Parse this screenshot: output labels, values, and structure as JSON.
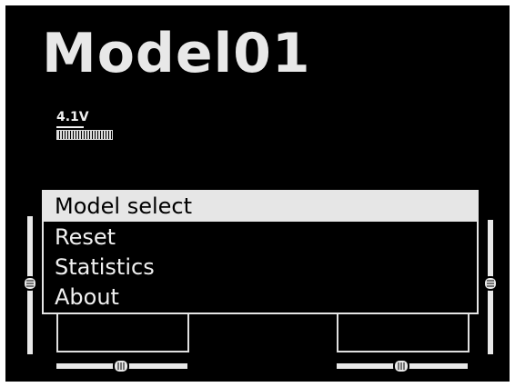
{
  "header": {
    "model_name": "Model01"
  },
  "battery": {
    "voltage_label": "4.1V",
    "level": 1.0
  },
  "menu": {
    "selected_index": 0,
    "items": [
      {
        "label": "Model select"
      },
      {
        "label": "Reset"
      },
      {
        "label": "Statistics"
      },
      {
        "label": "About"
      }
    ]
  },
  "trims": {
    "left_vertical_icon": "trim-knob-icon",
    "right_vertical_icon": "trim-knob-icon",
    "left_horizontal_icon": "trim-knob-icon",
    "right_horizontal_icon": "trim-knob-icon"
  },
  "colors": {
    "background": "#000000",
    "foreground": "#e8e8e8",
    "highlight": "#e6e6e6"
  }
}
